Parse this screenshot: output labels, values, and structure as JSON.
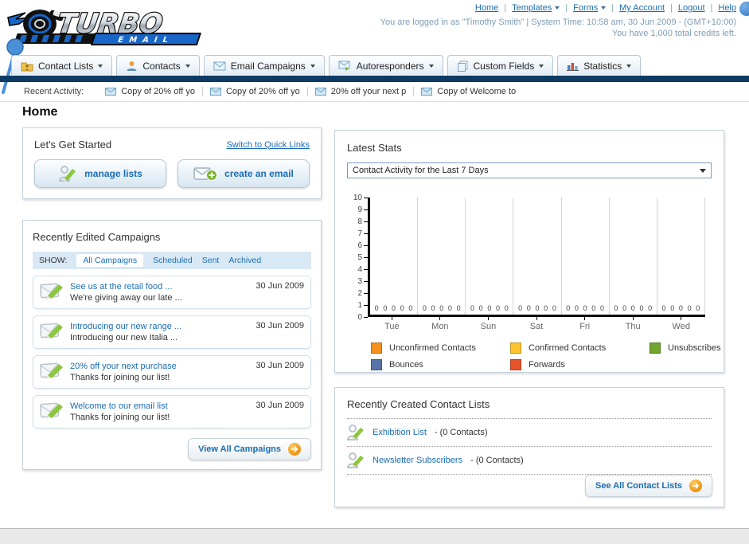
{
  "header": {
    "nav_links": [
      {
        "label": "Home"
      },
      {
        "label": "Templates",
        "dropdown": true
      },
      {
        "label": "Forms",
        "dropdown": true
      },
      {
        "label": "My Account"
      },
      {
        "label": "Logout"
      },
      {
        "label": "Help"
      }
    ],
    "login_info": "You are logged in as \"Timothy Smith\" | System Time: 10:58 am, 30 Jun 2009 - (GMT+10:00)",
    "credits_info": "You have 1,000 total credits left.",
    "logo_line1": "TURBO",
    "logo_line2": "EMAIL"
  },
  "tabs": [
    {
      "label": "Contact Lists",
      "icon": "contact-lists-icon"
    },
    {
      "label": "Contacts",
      "icon": "contacts-icon"
    },
    {
      "label": "Email Campaigns",
      "icon": "email-campaigns-icon"
    },
    {
      "label": "Autoresponders",
      "icon": "autoresponders-icon"
    },
    {
      "label": "Custom Fields",
      "icon": "custom-fields-icon"
    },
    {
      "label": "Statistics",
      "icon": "statistics-icon"
    }
  ],
  "recent_activity": {
    "label": "Recent Activity:",
    "items": [
      "Copy of 20% off yo",
      "Copy of 20% off yo",
      "20% off your next p",
      "Copy of Welcome to"
    ]
  },
  "page_title": "Home",
  "get_started": {
    "title": "Let's Get Started",
    "switch_link": "Switch to Quick Links",
    "manage_lists_label": "manage lists",
    "create_email_label": "create an email"
  },
  "campaigns": {
    "title": "Recently Edited Campaigns",
    "show_label": "SHOW:",
    "filters": [
      {
        "label": "All Campaigns",
        "active": true
      },
      {
        "label": "Scheduled",
        "active": false
      },
      {
        "label": "Sent",
        "active": false
      },
      {
        "label": "Archived",
        "active": false
      }
    ],
    "items": [
      {
        "title": "See us at the retail food ...",
        "subtitle": "We're giving away our late ...",
        "date": "30 Jun 2009"
      },
      {
        "title": "Introducing our new range ...",
        "subtitle": "Introducing our new Italia ...",
        "date": "30 Jun 2009"
      },
      {
        "title": "20% off your next purchase",
        "subtitle": "Thanks for joining our list!",
        "date": "30 Jun 2009"
      },
      {
        "title": "Welcome to our email list",
        "subtitle": "Thanks for joining our list!",
        "date": "30 Jun 2009"
      }
    ],
    "view_all_label": "View All Campaigns"
  },
  "stats": {
    "title": "Latest Stats",
    "dropdown_value": "Contact Activity for the Last 7 Days"
  },
  "chart_data": {
    "type": "bar",
    "categories": [
      "Tue",
      "Mon",
      "Sun",
      "Sat",
      "Fri",
      "Thu",
      "Wed"
    ],
    "series": [
      {
        "name": "Unconfirmed Contacts",
        "color": "#f5921e",
        "values": [
          0,
          0,
          0,
          0,
          0,
          0,
          0
        ]
      },
      {
        "name": "Confirmed Contacts",
        "color": "#fcc52f",
        "values": [
          0,
          0,
          0,
          0,
          0,
          0,
          0
        ]
      },
      {
        "name": "Unsubscribes",
        "color": "#72a432",
        "values": [
          0,
          0,
          0,
          0,
          0,
          0,
          0
        ]
      },
      {
        "name": "Bounces",
        "color": "#5674a7",
        "values": [
          0,
          0,
          0,
          0,
          0,
          0,
          0
        ]
      },
      {
        "name": "Forwards",
        "color": "#e5532a",
        "values": [
          0,
          0,
          0,
          0,
          0,
          0,
          0
        ]
      }
    ],
    "title": "",
    "xlabel": "",
    "ylabel": "",
    "ylim": [
      0,
      10
    ],
    "yticks": [
      0,
      1,
      2,
      3,
      4,
      5,
      6,
      7,
      8,
      9,
      10
    ],
    "grid": "vertical-only",
    "legend_position": "bottom",
    "value_labels_shown": true
  },
  "contact_lists": {
    "title": "Recently Created Contact Lists",
    "items": [
      {
        "name": "Exhibition List",
        "count_text": "- (0 Contacts)"
      },
      {
        "name": "Newsletter Subscribers",
        "count_text": "- (0 Contacts)"
      }
    ],
    "see_all_label": "See All Contact Lists"
  },
  "colors": {
    "accent_blue": "#1a6db3",
    "navy_bar": "#0e3b63",
    "logo_blue": "#1766c8",
    "pencil_green": "#8dc63f",
    "arrow_orange": "#f29a17"
  }
}
